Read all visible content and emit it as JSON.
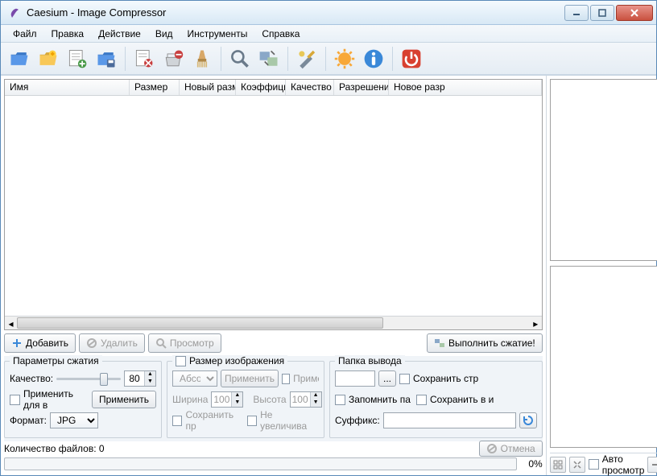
{
  "title": "Caesium - Image Compressor",
  "menu": {
    "file": "Файл",
    "edit": "Правка",
    "action": "Действие",
    "view": "Вид",
    "tools": "Инструменты",
    "help": "Справка"
  },
  "columns": {
    "name": "Имя",
    "size": "Размер",
    "newsize": "Новый разм",
    "ratio": "Коэффици",
    "quality": "Качество",
    "resolution": "Разрешени",
    "newres": "Новое разр"
  },
  "buttons": {
    "add": "Добавить",
    "remove": "Удалить",
    "preview": "Просмотр",
    "compress": "Выполнить сжатие!",
    "apply": "Применить",
    "applyimg": "Применить",
    "cancel": "Отмена"
  },
  "compression": {
    "group": "Параметры сжатия",
    "quality_label": "Качество:",
    "quality_value": "80",
    "same_all": "Применить для в",
    "format_label": "Формат:",
    "format_value": "JPG"
  },
  "imagesize": {
    "group": "Размер изображения",
    "mode": "Абсол",
    "apply_short": "Применить",
    "apply_chk": "Примен",
    "width_label": "Ширина",
    "width_value": "100",
    "height_label": "Высота",
    "height_value": "100",
    "keep_ratio": "Сохранить пр",
    "no_enlarge": "Не увеличива"
  },
  "output": {
    "group": "Папка вывода",
    "browse": "...",
    "keep_struct": "Сохранить стр",
    "remember": "Запомнить па",
    "save_in": "Сохранить в и",
    "suffix_label": "Суффикс:",
    "suffix_value": ""
  },
  "status": {
    "count_label": "Количество файлов: 0",
    "pct": "0%"
  },
  "right": {
    "auto_preview": "Авто просмотр"
  }
}
